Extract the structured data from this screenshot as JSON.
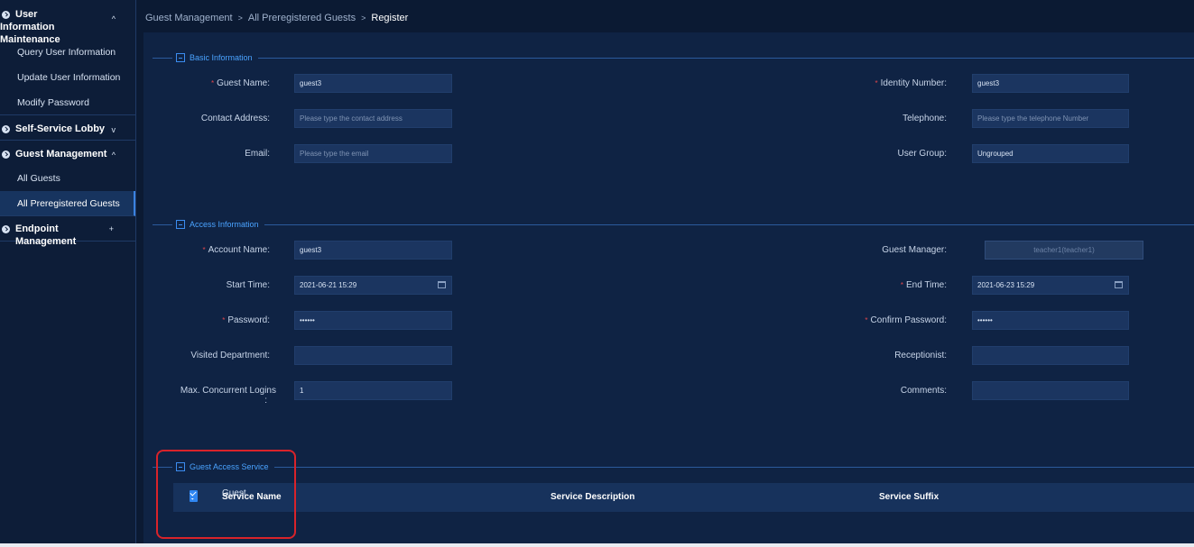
{
  "sidebar": {
    "groups": [
      {
        "label": "User Information Maintenance",
        "chevron": "^",
        "items": [
          "Query User Information",
          "Update User Information",
          "Modify Password"
        ]
      },
      {
        "label": "Self-Service Lobby",
        "chevron": "v"
      },
      {
        "label": "Guest Management",
        "chevron": "^",
        "items": [
          "All Guests",
          "All Preregistered Guests"
        ],
        "active_item": "All Preregistered Guests"
      },
      {
        "label": "Endpoint Management",
        "chevron": "+"
      }
    ]
  },
  "breadcrumb": {
    "items": [
      "Guest Management",
      "All Preregistered Guests"
    ],
    "separator": ">",
    "current": "Register"
  },
  "basic_info": {
    "title": "Basic Information",
    "guest_name": {
      "label": "Guest Name:",
      "value": "guest3"
    },
    "identity_number": {
      "label": "Identity Number:",
      "value": "guest3"
    },
    "contact_address": {
      "label": "Contact Address:",
      "placeholder": "Please type the contact address"
    },
    "telephone": {
      "label": "Telephone:",
      "placeholder": "Please type the telephone Number"
    },
    "email": {
      "label": "Email:",
      "placeholder": "Please type the email"
    },
    "user_group": {
      "label": "User Group:",
      "value": "Ungrouped"
    }
  },
  "access_info": {
    "title": "Access Information",
    "account_name": {
      "label": "Account Name:",
      "value": "guest3"
    },
    "guest_manager": {
      "label": "Guest Manager:",
      "value": "teacher1(teacher1)"
    },
    "start_time": {
      "label": "Start Time:",
      "value": "2021-06-21 15:29"
    },
    "end_time": {
      "label": "End Time:",
      "value": "2021-06-23 15:29"
    },
    "password": {
      "label": "Password:",
      "value": "••••••"
    },
    "confirm_password": {
      "label": "Confirm Password:",
      "value": "••••••"
    },
    "visited_department": {
      "label": "Visited Department:",
      "value": ""
    },
    "receptionist": {
      "label": "Receptionist:",
      "value": ""
    },
    "max_logins": {
      "label": "Max. Concurrent Logins",
      "colon": ":",
      "value": "1"
    },
    "comments": {
      "label": "Comments:",
      "value": ""
    }
  },
  "guest_access": {
    "title": "Guest Access Service",
    "columns": [
      "Service Name",
      "Service Description",
      "Service Suffix"
    ],
    "rows": [
      {
        "name": "Guest",
        "checked": true
      }
    ],
    "header_checked": true
  },
  "colors": {
    "accent": "#4aa3ff",
    "required": "#e0474c",
    "highlight": "#d8232a",
    "background": "#0b1a33"
  }
}
